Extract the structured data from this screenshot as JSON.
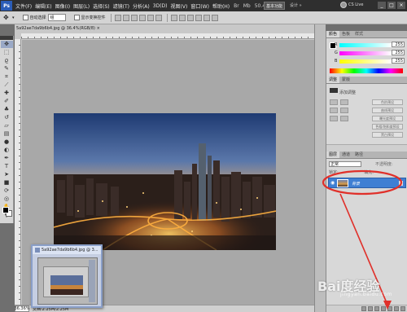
{
  "app": {
    "logo": "Ps",
    "menu": [
      "文件(F)",
      "编辑(E)",
      "图像(I)",
      "图层(L)",
      "选择(S)",
      "滤镜(T)",
      "分析(A)",
      "3D(D)",
      "视图(V)",
      "窗口(W)",
      "帮助(H)"
    ],
    "menu_controls": [
      "Br",
      "Mb",
      "50.4",
      "▭",
      "▦"
    ],
    "workspace_button": "基本功能",
    "workspace_more": "设计 »",
    "cslive": "CS Live",
    "window_buttons": [
      "_",
      "□",
      "×"
    ]
  },
  "options_bar": {
    "auto_select_label": "自动选择",
    "auto_select_value": "组",
    "show_transform_label": "显示变换控件"
  },
  "document": {
    "tab_title": "5a92ae7da9b6b4.jpg @ 36.4%(RGB/8) ×",
    "zoom": "36.36%",
    "status": "文档:2.25M/2.25M"
  },
  "navigator_popup": {
    "title": "5a92ae7da9b6b4.jpg @ 3..."
  },
  "panels": {
    "color_tabs": [
      "颜色",
      "色板",
      "样式"
    ],
    "color": {
      "channels": [
        {
          "label": "R",
          "value": "255",
          "color": "#ff0000"
        },
        {
          "label": "G",
          "value": "255",
          "color": "#00cc00"
        },
        {
          "label": "B",
          "value": "255",
          "color": "#0000ff"
        }
      ]
    },
    "adjust_tabs": [
      "调整",
      "蒙版"
    ],
    "adjust": {
      "title": "添加调整",
      "buttons": [
        "色阶预设",
        "曲线预设",
        "曝光度预设",
        "色相/饱和度预设",
        "黑白预设"
      ]
    },
    "layer_tabs": [
      "图层",
      "通道",
      "路径"
    ],
    "layers": {
      "blend_mode": "正常",
      "opacity_label": "不透明度:",
      "lock_label": "锁定:",
      "fill_label": "填充:",
      "rows": [
        {
          "name": "背景",
          "selected": true
        }
      ]
    }
  },
  "watermark": {
    "main": "Bai度经验",
    "sub": "jingyan.baidu.com"
  },
  "annotation_color": "#e0302a"
}
